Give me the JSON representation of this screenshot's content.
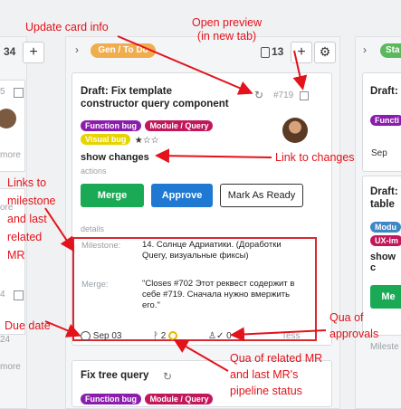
{
  "left_column": {
    "count": "34",
    "add": "+",
    "rows": [
      "5",
      "more",
      "ore",
      "4",
      "24",
      "more"
    ]
  },
  "board": {
    "list_badge": "Gen / To Do",
    "count": "13",
    "add": "+",
    "card1": {
      "title_line1": "Draft: Fix template",
      "title_line2": "constructor query component",
      "number": "#719",
      "labels": [
        "Function bug",
        "Module / Query",
        "Visual bug"
      ],
      "stars": "★☆☆",
      "changes": "show changes",
      "actions_caption": "actions",
      "merge": "Merge",
      "approve": "Approve",
      "mark_ready": "Mark As Ready",
      "details_caption": "details",
      "milestone_key": "Milestone:",
      "milestone_val": "14. Солнце Адриатики. (Доработки Query, визуальные фиксы)",
      "merge_key": "Merge:",
      "merge_val": "\"Closes #702 Этот реквест содержит в себе #719. Сначала нужно вмержить его.\"",
      "due": "Sep 03",
      "mr_count": "2",
      "approvals": "0",
      "assignee": "Tess"
    },
    "card2": {
      "title": "Fix tree query",
      "labels": [
        "Function bug",
        "Module / Query"
      ]
    }
  },
  "right_column": {
    "badge": "Sta",
    "card1_title": "Draft:",
    "card1_label": "Functi",
    "card1_sep": "Sep",
    "card2_title_l1": "Draft:",
    "card2_title_l2": "table",
    "card2_labels": [
      "Modu",
      "UX-im"
    ],
    "card2_show": "show c",
    "card2_btn": "Me",
    "bottom": "Mileste"
  },
  "annotations": {
    "update": "Update card info",
    "preview": "Open preview\n(in new tab)",
    "links_changes": "Link to changes",
    "links_milestone": "Links to\nmilestone\nand last\nrelated\nMR",
    "due": "Due date",
    "qua_mr": "Qua of related MR\nand last MR's\npipeline status",
    "qua_approvals": "Qua of\napprovals"
  },
  "colors": {
    "merge": "#1aaa55",
    "approve": "#1f78d1",
    "annotation": "#e3121b",
    "function_bug": "#8b1dac",
    "module_query": "#c2185b",
    "visual_bug": "#e6d400",
    "badge": "#f0ad4e",
    "right_badge": "#5cb85c"
  }
}
